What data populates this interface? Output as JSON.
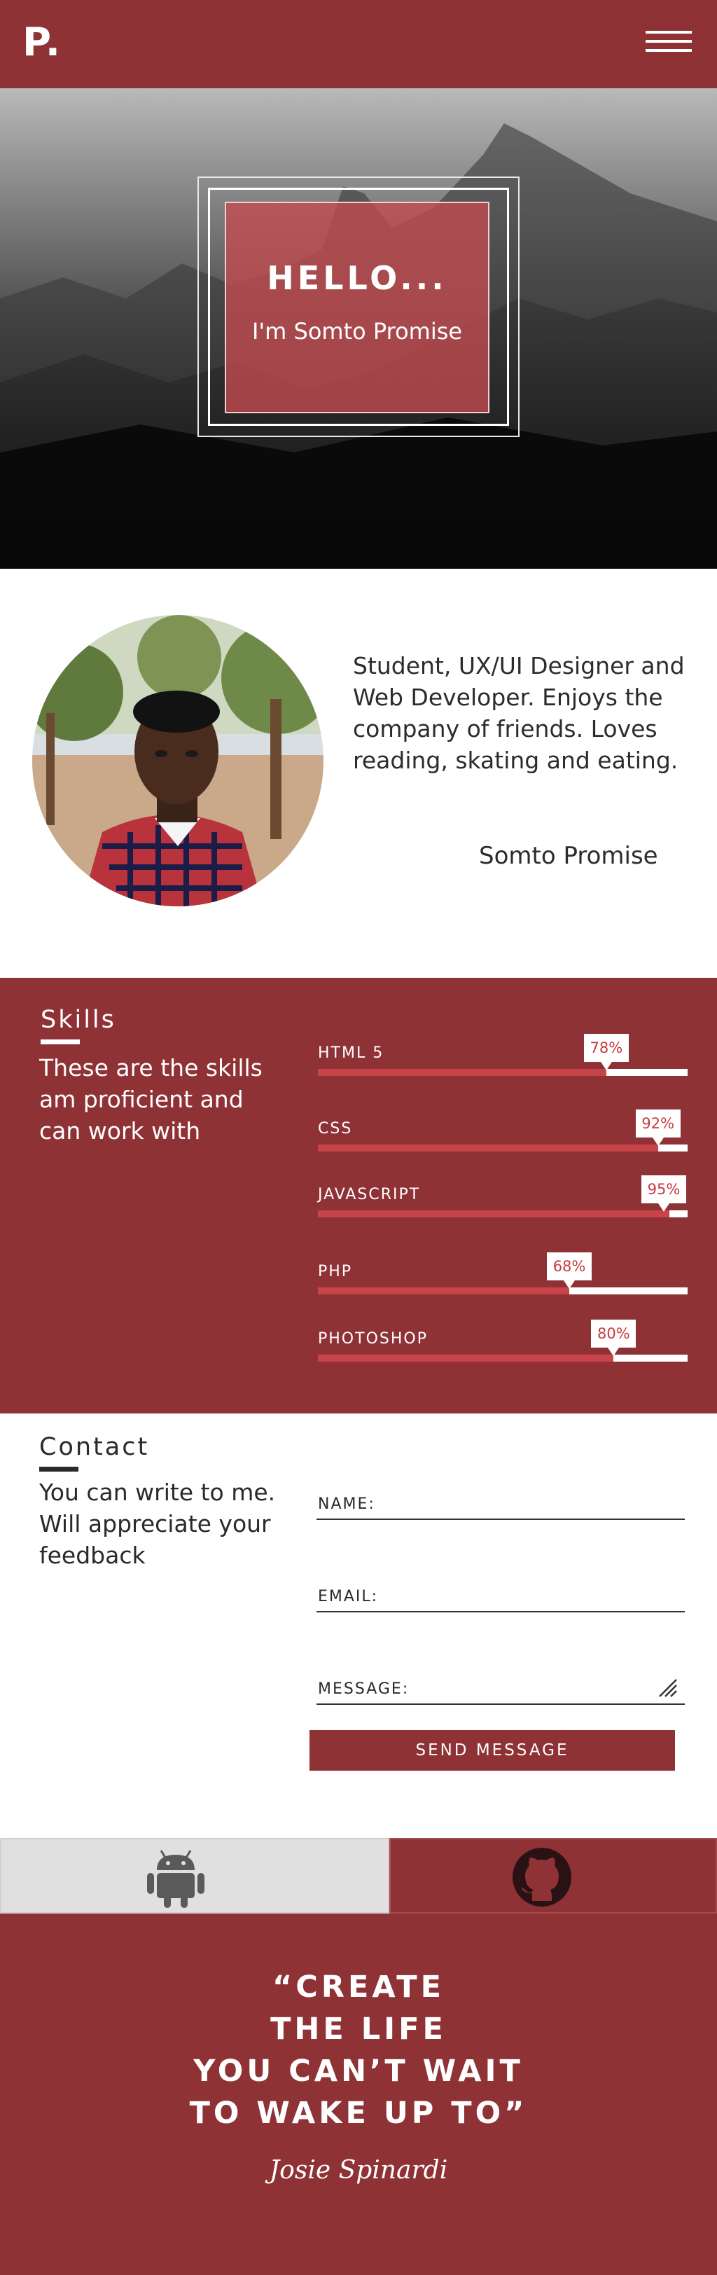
{
  "header": {
    "logo": "P.",
    "menu_icon": "hamburger-menu-icon"
  },
  "hero": {
    "title": "HELLO...",
    "subtitle": "I'm Somto Promise"
  },
  "about": {
    "bio": "Student, UX/UI Designer and Web Developer. Enjoys the company of friends. Loves reading, skating and eating.",
    "name": "Somto Promise"
  },
  "skills": {
    "title": "Skills",
    "description": "These are the skills am proficient and can work with",
    "items": [
      {
        "label": "HTML 5",
        "percent_label": "78%",
        "percent": 78
      },
      {
        "label": "CSS",
        "percent_label": "92%",
        "percent": 92
      },
      {
        "label": "JAVASCRIPT",
        "percent_label": "95%",
        "percent": 95
      },
      {
        "label": "PHP",
        "percent_label": "68%",
        "percent": 68
      },
      {
        "label": "PHOTOSHOP",
        "percent_label": "80%",
        "percent": 80
      }
    ]
  },
  "contact": {
    "title": "Contact",
    "description": "You can write to me. Will appreciate your feedback",
    "fields": {
      "name_label": "NAME:",
      "email_label": "EMAIL:",
      "message_label": "MESSAGE:"
    },
    "send_label": "SEND MESSAGE"
  },
  "social": {
    "android_icon": "android-icon",
    "github_icon": "github-icon"
  },
  "quote": {
    "lines": [
      "“CREATE",
      "THE LIFE",
      "YOU CAN’T WAIT",
      "TO WAKE UP TO”"
    ],
    "author": "Josie Spinardi"
  },
  "colors": {
    "brand": "#8e3236",
    "bar_fill": "#c84448",
    "hero_card": "#c44c50"
  }
}
